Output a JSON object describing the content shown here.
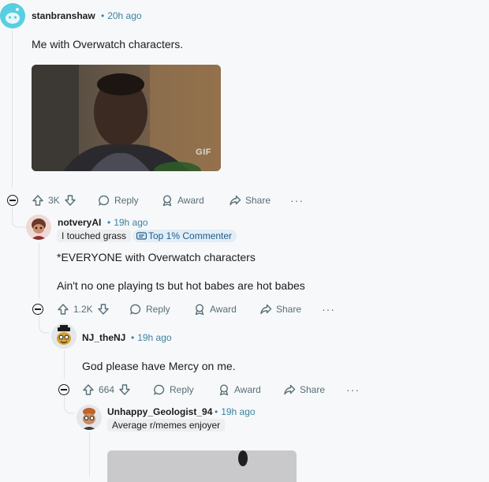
{
  "comments": [
    {
      "username": "stanbranshaw",
      "time": "20h ago",
      "text": "Me with Overwatch characters.",
      "media_label": "GIF",
      "votes": "3K",
      "reply_label": "Reply",
      "award_label": "Award",
      "share_label": "Share",
      "more_label": "···"
    },
    {
      "username": "notveryAI",
      "time": "19h ago",
      "flair": "I touched grass",
      "badge": "Top 1% Commenter",
      "text_lines": [
        "*EVERYONE with Overwatch characters",
        "Ain't no one playing ts but hot babes are hot babes"
      ],
      "votes": "1.2K",
      "reply_label": "Reply",
      "award_label": "Award",
      "share_label": "Share",
      "more_label": "···"
    },
    {
      "username": "NJ_theNJ",
      "time": "19h ago",
      "text": "God please have Mercy on me.",
      "votes": "664",
      "reply_label": "Reply",
      "award_label": "Award",
      "share_label": "Share",
      "more_label": "···"
    },
    {
      "username": "Unhappy_Geologist_94",
      "time": "19h ago",
      "flair": "Average r/memes enjoyer"
    }
  ],
  "colors": {
    "meta_blue": "#3b82a3",
    "action_gray": "#576f76",
    "thread_line": "#dfe3e8",
    "background": "#f7f8fa"
  }
}
